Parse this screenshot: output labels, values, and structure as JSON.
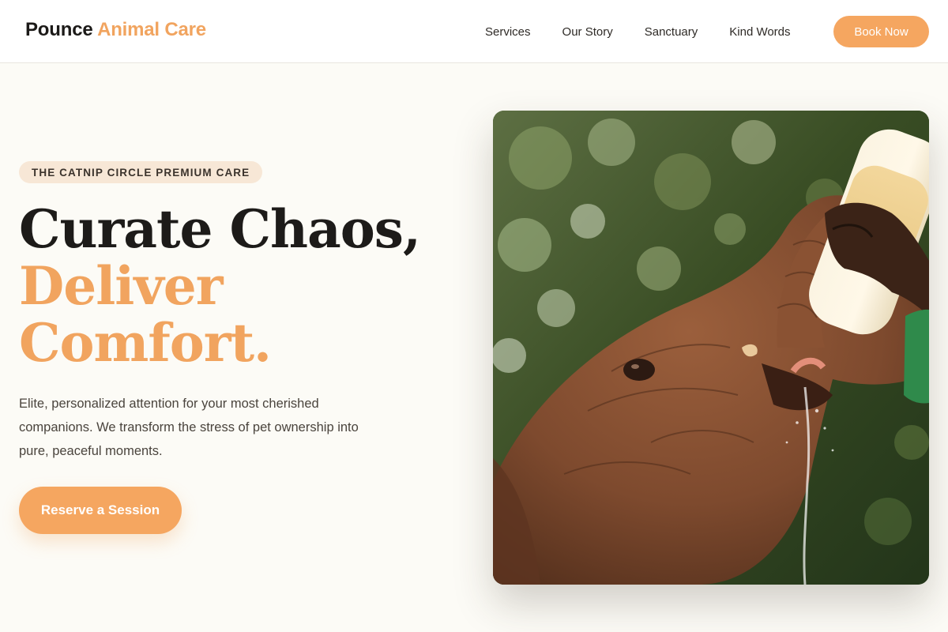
{
  "header": {
    "logo_main": "Pounce",
    "logo_accent": "Animal Care",
    "nav": [
      {
        "label": "Services"
      },
      {
        "label": "Our Story"
      },
      {
        "label": "Sanctuary"
      },
      {
        "label": "Kind Words"
      }
    ],
    "cta_label": "Book Now"
  },
  "hero": {
    "badge": "THE CATNIP CIRCLE PREMIUM CARE",
    "headline_line1": "Curate Chaos,",
    "headline_line2": "Deliver",
    "headline_line3": "Comfort.",
    "description": "Elite, personalized attention for your most cherished companions. We transform the stress of pet ownership into pure, peaceful moments.",
    "cta_label": "Reserve a Session",
    "image_subject": "caretaker bottle-feeding a baby elephant"
  },
  "colors": {
    "accent": "#f5a660",
    "accent_text": "#f1a45f",
    "background": "#fcfbf6",
    "badge_bg": "#f7e7d6",
    "header_bg": "#ffffff"
  }
}
